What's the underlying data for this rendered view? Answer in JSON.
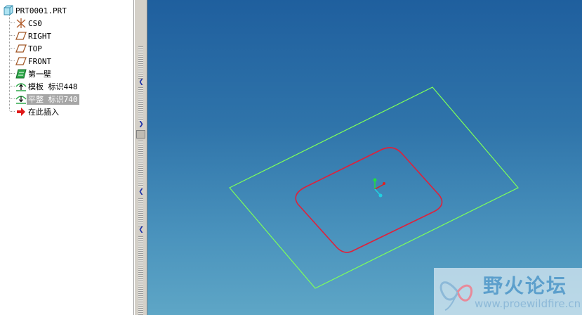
{
  "model_tree": {
    "items": [
      {
        "label": "PRT0001.PRT",
        "icon": "part-icon"
      },
      {
        "label": "CS0",
        "icon": "coordinate-system-icon"
      },
      {
        "label": "RIGHT",
        "icon": "datum-plane-icon"
      },
      {
        "label": "TOP",
        "icon": "datum-plane-icon"
      },
      {
        "label": "FRONT",
        "icon": "datum-plane-icon"
      },
      {
        "label": "第一壁",
        "icon": "first-wall-icon"
      },
      {
        "label": "模板 标识448",
        "icon": "form-feature-icon"
      },
      {
        "label": "平整 标识740",
        "icon": "flatten-feature-icon"
      },
      {
        "label": "在此插入",
        "icon": "insert-here-arrow-icon"
      }
    ],
    "selected_index": 7
  },
  "splitter": {
    "arrows": [
      "collapse-left-arrow-icon",
      "expand-right-arrow-icon",
      "collapse-left-arrow-icon",
      "collapse-left-arrow-icon"
    ]
  },
  "viewport": {
    "outer_edge_color": "#7dff5a",
    "inner_edge_color": "#e0203a",
    "csys_colors": {
      "x": "#e02020",
      "y": "#20e040",
      "z": "#20d0e0"
    }
  },
  "watermark": {
    "title": "野火论坛",
    "url": "www.proewildfire.cn"
  }
}
